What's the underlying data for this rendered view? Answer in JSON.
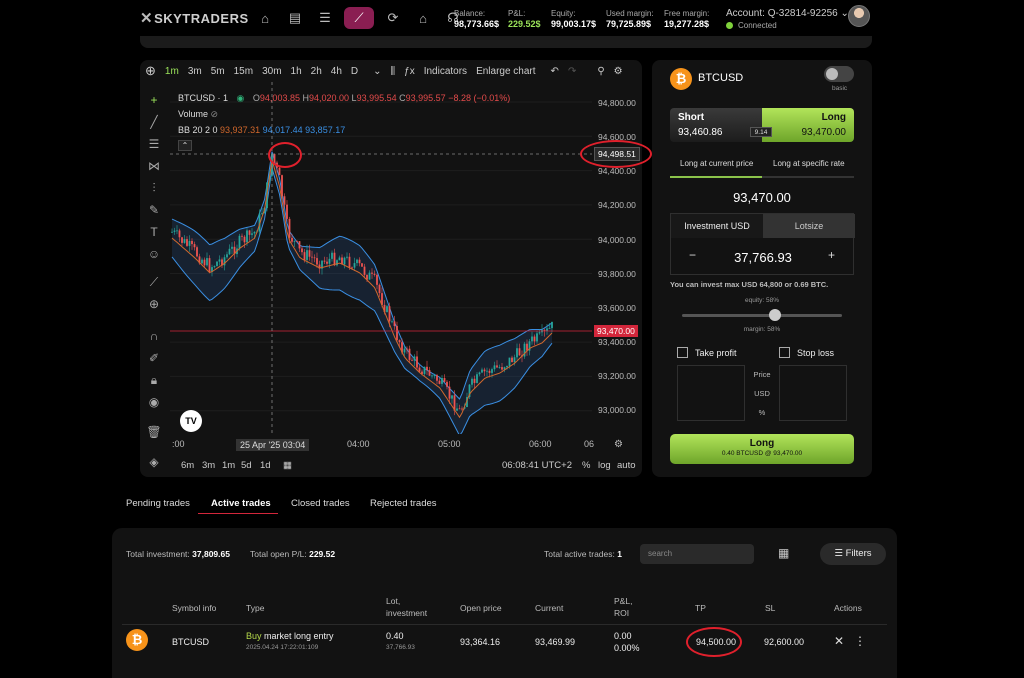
{
  "brand": "SKYTRADERS",
  "top_stats": [
    {
      "label": "Balance:",
      "value": "98,773.66$",
      "green": false
    },
    {
      "label": "P&L:",
      "value": "229.52$",
      "green": true
    },
    {
      "label": "Equity:",
      "value": "99,003.17$",
      "green": false
    },
    {
      "label": "Used margin:",
      "value": "79,725.89$",
      "green": false
    },
    {
      "label": "Free margin:",
      "value": "19,277.28$",
      "green": false
    }
  ],
  "account": {
    "label": "Account: Q-32814-92256",
    "status": "Connected"
  },
  "chart": {
    "timeframes": [
      "1m",
      "3m",
      "5m",
      "15m",
      "30m",
      "1h",
      "2h",
      "4h",
      "D"
    ],
    "active_timeframe": "1m",
    "indicators_label": "Indicators",
    "enlarge_label": "Enlarge chart",
    "symbol": "BTCUSD · 1",
    "ohlc": {
      "o": "94,003.85",
      "h": "94,020.00",
      "l": "93,995.54",
      "c": "93,995.57",
      "change": "−8.28 (−0.01%)"
    },
    "volume_label": "Volume",
    "bb_label": "BB 20 2 0",
    "bb_values": [
      "93,937.31",
      "94,017.44",
      "93,857.17"
    ],
    "y_ticks": [
      "94,800.00",
      "94,600.00",
      "94,400.00",
      "94,200.00",
      "94,000.00",
      "93,800.00",
      "93,600.00",
      "93,400.00",
      "93,200.00",
      "93,000.00"
    ],
    "crosshair_price": "94,498.51",
    "current_price": "93,470.00",
    "x_ticks": [
      ":00",
      "04:00",
      "05:00",
      "06:00",
      "06"
    ],
    "crosshair_time": "25 Apr '25   03:04",
    "ranges": [
      "6m",
      "3m",
      "1m",
      "5d",
      "1d"
    ],
    "clock": "06:08:41 UTC+2",
    "scale_opts": [
      "%",
      "log",
      "auto"
    ]
  },
  "order": {
    "symbol": "BTCUSD",
    "mode_label": "basic",
    "short_label": "Short",
    "short_price": "93,460.86",
    "long_label": "Long",
    "long_price": "93,470.00",
    "spread": "9.14",
    "tab_current": "Long at current price",
    "tab_specific": "Long at specific rate",
    "price": "93,470.00",
    "invest_tab": "Investment USD",
    "lot_tab": "Lotsize",
    "invest_value": "37,766.93",
    "hint": "You can invest max USD 64,800 or 0.69 BTC.",
    "equity_lbl": "equity: 58%",
    "margin_lbl": "margin: 58%",
    "slider_pct": 58,
    "take_profit": "Take profit",
    "stop_loss": "Stop loss",
    "mid_labels": [
      "Price",
      "USD",
      "%"
    ],
    "button_title": "Long",
    "button_sub": "0.40 BTCUSD @ 93,470.00"
  },
  "trade_tabs": [
    "Pending trades",
    "Active trades",
    "Closed trades",
    "Rejected trades"
  ],
  "trades": {
    "total_investment_label": "Total investment:",
    "total_investment": "37,809.65",
    "total_pl_label": "Total open P/L:",
    "total_pl": "229.52",
    "active_label": "Total active trades:",
    "active_count": "1",
    "search_placeholder": "search",
    "filters_label": "Filters",
    "headers": {
      "symbol": "Symbol info",
      "type": "Type",
      "lot1": "Lot,",
      "lot2": "investment",
      "open": "Open price",
      "current": "Current",
      "pl1": "P&L,",
      "pl2": "ROI",
      "tp": "TP",
      "sl": "SL",
      "actions": "Actions"
    },
    "row": {
      "symbol": "BTCUSD",
      "type_buy": "Buy",
      "type_rest": " market long entry",
      "date": "2025.04.24 17:22:01:109",
      "lot": "0.40",
      "investment": "37,766.93",
      "open": "93,364.16",
      "current": "93,469.99",
      "pl": "0.00",
      "roi": "0.00%",
      "tp": "94,500.00",
      "sl": "92,600.00"
    }
  },
  "colors": {
    "accent_green": "#9be35a",
    "red_line": "#d3263b",
    "bb_upper": "#3a8fe3",
    "bb_mid": "#d2682c"
  }
}
